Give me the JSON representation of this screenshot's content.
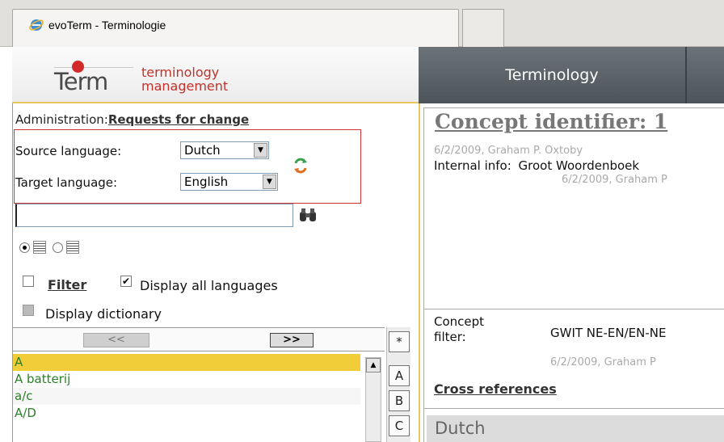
{
  "window": {
    "tab_title": "evoTerm - Terminologie"
  },
  "header": {
    "logo_word": "Term",
    "logo_text_line1": "terminology",
    "logo_text_line2": "management",
    "nav_item": "Terminology",
    "colors": {
      "nav_bg": "#555d63",
      "accent": "#e6c85a",
      "brand_red": "#c2322a"
    }
  },
  "left": {
    "admin_label": "Administration:",
    "admin_link": "Requests for change",
    "source_label": "Source language:",
    "source_value": "Dutch",
    "target_label": "Target language:",
    "target_value": "English",
    "search_value": "",
    "filter_label": "Filter",
    "display_all_label": "Display all languages",
    "display_all_checked": true,
    "display_dict_label": "Display dictionary",
    "display_dict_checked": false,
    "pager_prev": "<<",
    "pager_next": ">>",
    "terms": [
      "A",
      "A batterij",
      "a/c",
      "A/D"
    ],
    "selected_term_index": 0,
    "alphabet": [
      "*",
      "A",
      "B",
      "C"
    ],
    "view_mode_selected": "list"
  },
  "right": {
    "concept_title": "Concept identifier: 1",
    "concept_meta": "6/2/2009, Graham P. Oxtoby",
    "internal_label": "Internal info:",
    "internal_value": "Groot Woordenboek",
    "internal_meta": "6/2/2009, Graham P",
    "concept_filter_label_1": "Concept",
    "concept_filter_label_2": "filter:",
    "concept_filter_value": "GWIT NE-EN/EN-NE",
    "concept_filter_meta": "6/2/2009, Graham P",
    "cross_refs": "Cross references",
    "language_section": "Dutch"
  }
}
